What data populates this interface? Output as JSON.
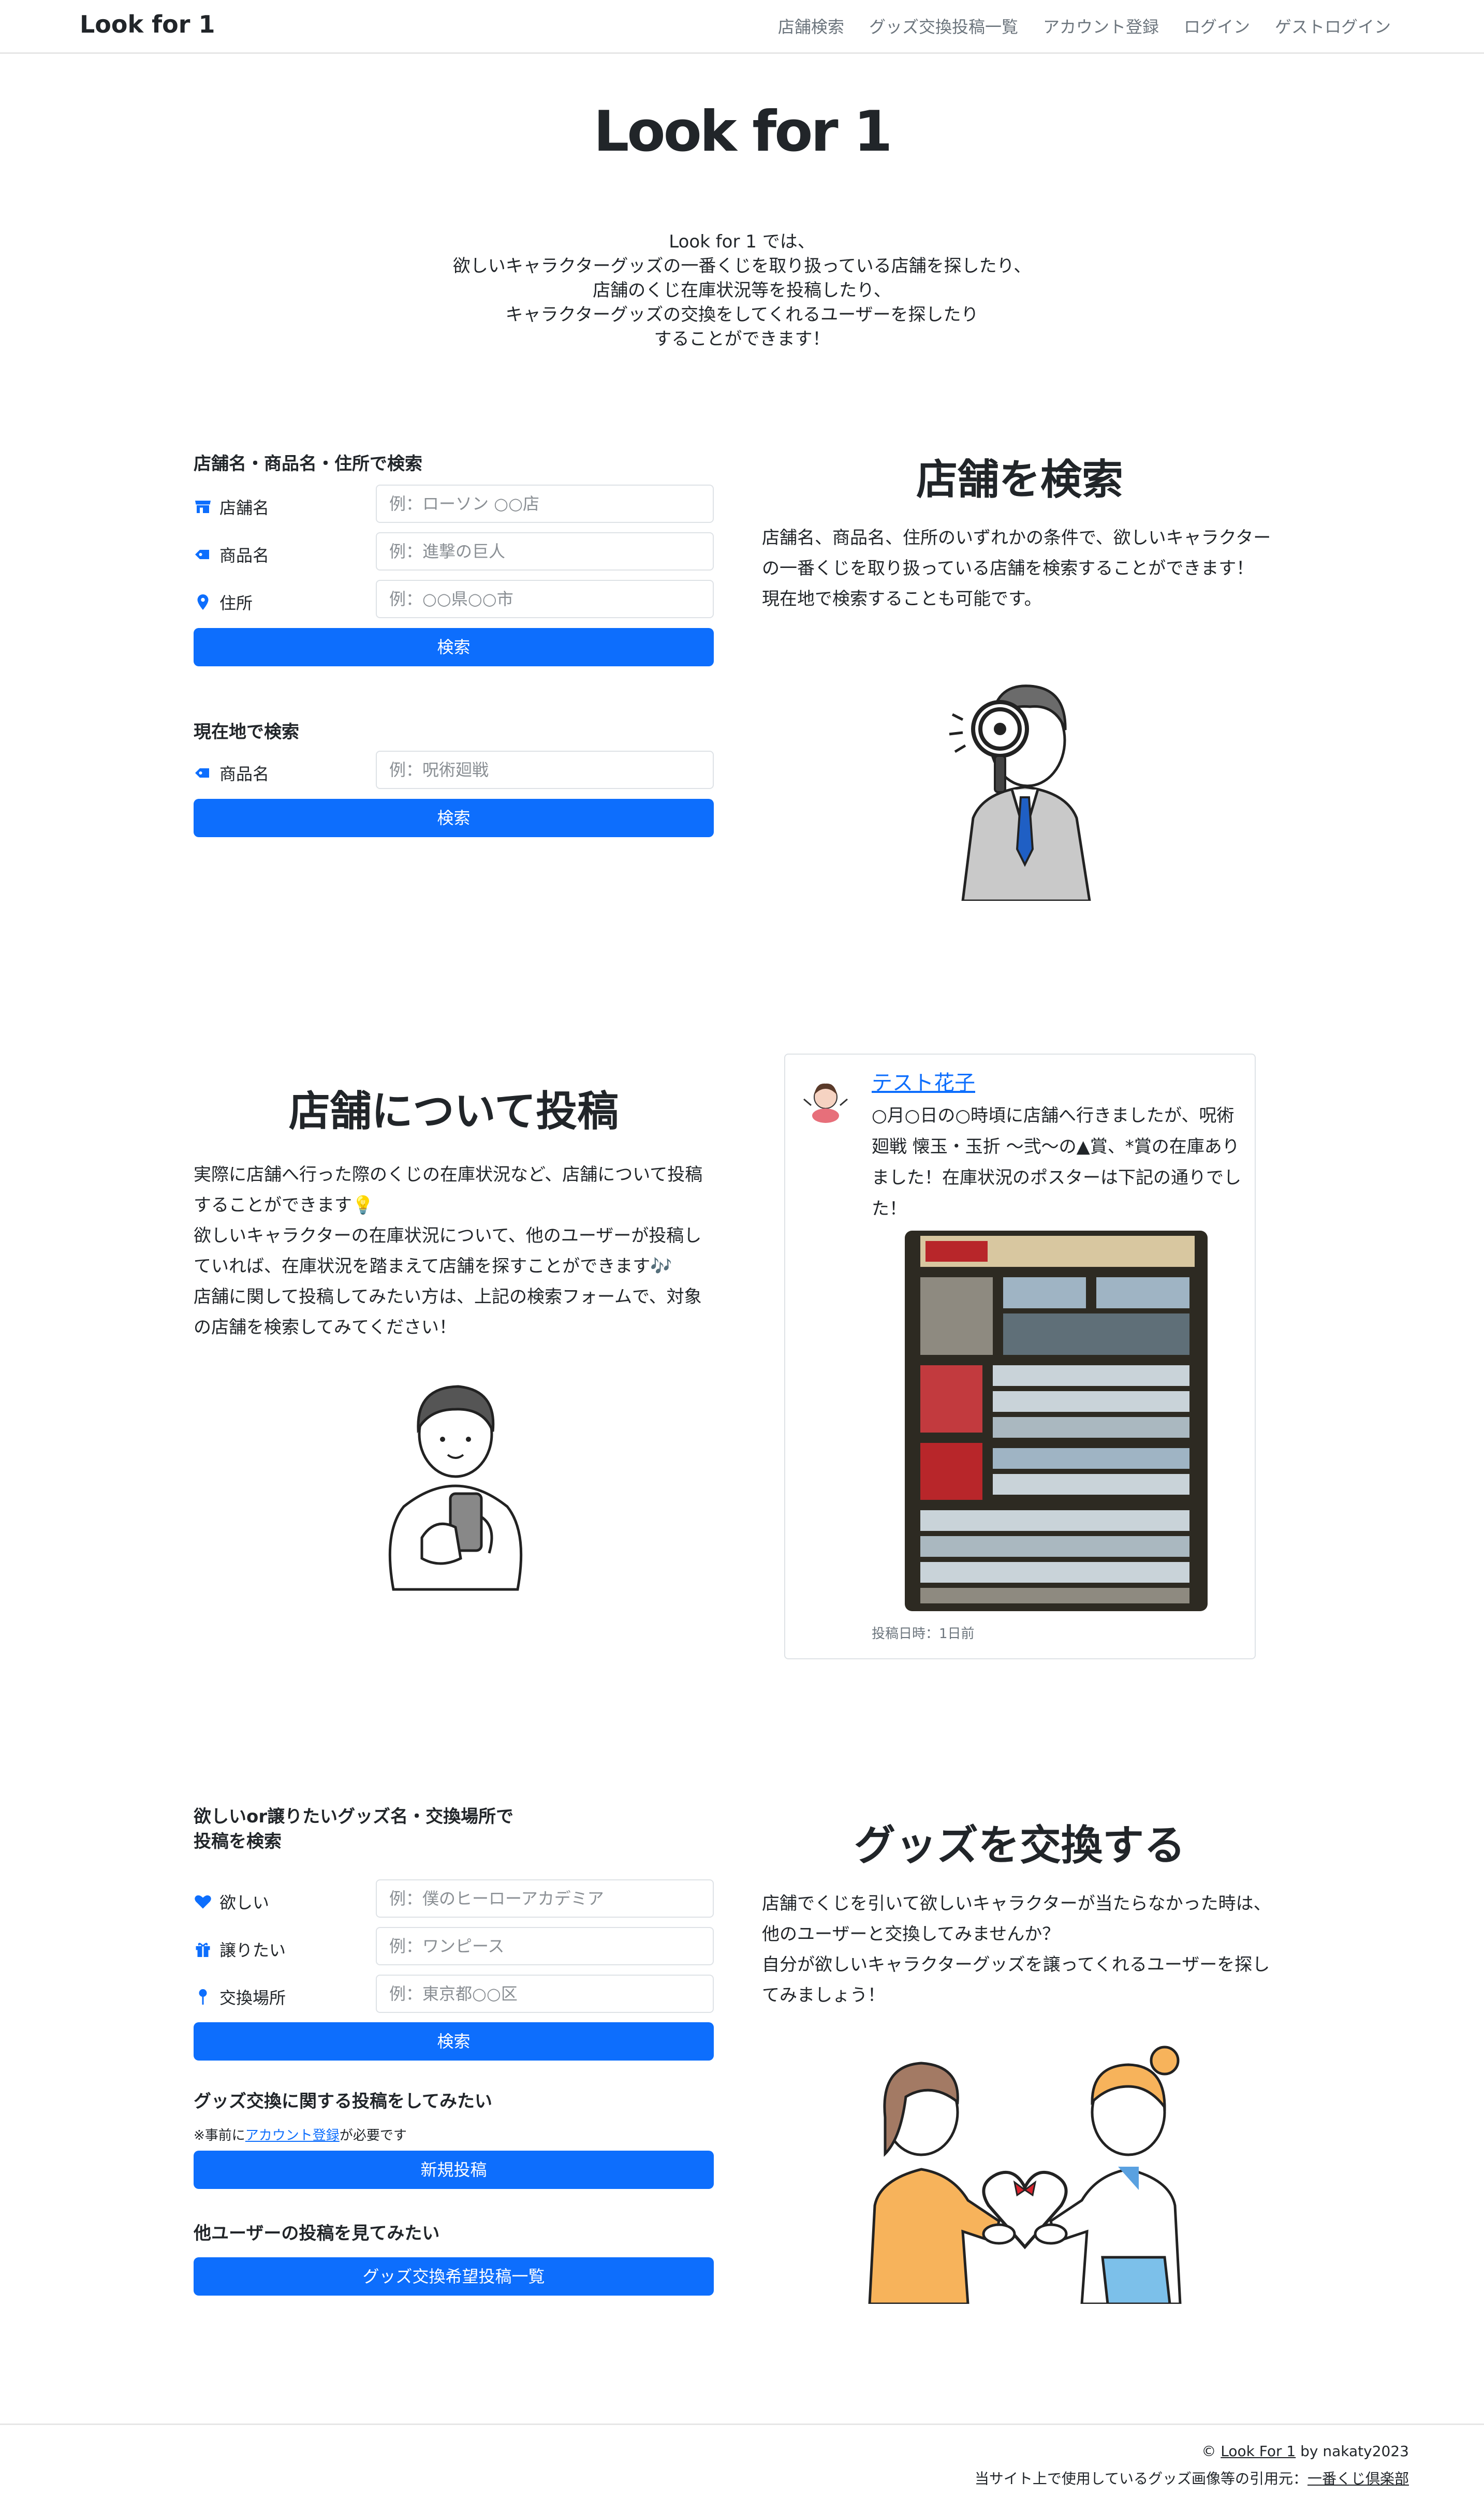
{
  "navbar": {
    "brand": "Look for 1",
    "links": [
      "店舗検索",
      "グッズ交換投稿一覧",
      "アカウント登録",
      "ログイン",
      "ゲストログイン"
    ]
  },
  "hero": {
    "title": "Look for 1",
    "lines": [
      "Look for 1 では、",
      "欲しいキャラクターグッズの一番くじを取り扱っている店舗を探したり、",
      "店舗のくじ在庫状況等を投稿したり、",
      "キャラクターグッズの交換をしてくれるユーザーを探したり",
      "することができます！"
    ]
  },
  "shop_search": {
    "heading": "店舗名・商品名・住所で検索",
    "fields": [
      {
        "label": "店舗名",
        "icon": "store-icon",
        "placeholder": "例：ローソン ○○店"
      },
      {
        "label": "商品名",
        "icon": "tag-icon",
        "placeholder": "例：進撃の巨人"
      },
      {
        "label": "住所",
        "icon": "map-pin-icon",
        "placeholder": "例：○○県○○市"
      }
    ],
    "button": "検索"
  },
  "location_search": {
    "heading": "現在地で検索",
    "fields": [
      {
        "label": "商品名",
        "icon": "tag-icon",
        "placeholder": "例：呪術廻戦"
      }
    ],
    "button": "検索"
  },
  "search_info": {
    "title": "店舗を検索",
    "text": "店舗名、商品名、住所のいずれかの条件で、欲しいキャラクターの一番くじを取り扱っている店舗を検索することができます！\n現在地で検索することも可能です。"
  },
  "post_info": {
    "title": "店舗について投稿",
    "text": "実際に店舗へ行った際のくじの在庫状況など、店舗について投稿することができます💡\n欲しいキャラクターの在庫状況について、他のユーザーが投稿していれば、在庫状況を踏まえて店舗を探すことができます🎶\n店舗に関して投稿してみたい方は、上記の検索フォームで、対象の店舗を検索してみてください！"
  },
  "sample_post": {
    "user": "テスト花子",
    "body": "○月○日の○時頃に店舗へ行きましたが、呪術廻戦 懐玉・玉折 〜弐〜の▲賞、*賞の在庫ありました！在庫状況のポスターは下記の通りでした！",
    "date": "投稿日時：1日前"
  },
  "goods_search": {
    "heading": "欲しいor譲りたいグッズ名・交換場所で\n投稿を検索",
    "fields": [
      {
        "label": "欲しい",
        "icon": "heart-icon",
        "placeholder": "例：僕のヒーローアカデミア"
      },
      {
        "label": "譲りたい",
        "icon": "gift-icon",
        "placeholder": "例：ワンピース"
      },
      {
        "label": "交換場所",
        "icon": "pin-icon",
        "placeholder": "例：東京都○○区"
      }
    ],
    "button": "検索"
  },
  "new_post": {
    "heading": "グッズ交換に関する投稿をしてみたい",
    "note_prefix": "※事前に",
    "note_link": "アカウント登録",
    "note_suffix": "が必要です",
    "button": "新規投稿"
  },
  "view_posts": {
    "heading": "他ユーザーの投稿を見てみたい",
    "button": "グッズ交換希望投稿一覧"
  },
  "exchange_info": {
    "title": "グッズを交換する",
    "text": "店舗でくじを引いて欲しいキャラクターが当たらなかった時は、他のユーザーと交換してみませんか？\n自分が欲しいキャラクターグッズを譲ってくれるユーザーを探してみましょう！"
  },
  "footer": {
    "copyright_prefix": "© ",
    "copyright_link": "Look For 1",
    "copyright_suffix": " by nakaty2023",
    "source_prefix": "当サイト上で使用しているグッズ画像等の引用元：",
    "source_link": "一番くじ倶楽部"
  },
  "colors": {
    "primary": "#0d6efd",
    "text": "#212529",
    "muted": "#6c757d",
    "border": "#dee2e6"
  }
}
